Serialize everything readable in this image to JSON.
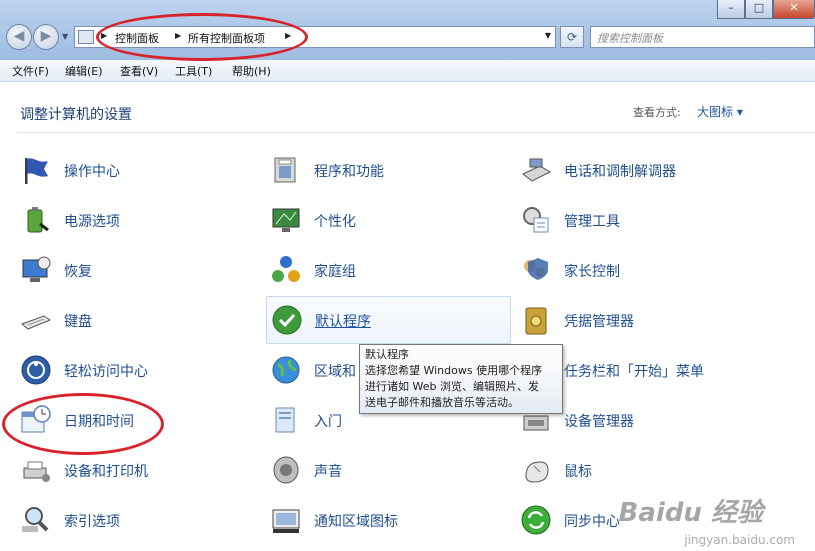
{
  "address": {
    "crumbs": [
      "控制面板",
      "所有控制面板项"
    ]
  },
  "search": {
    "placeholder": "搜索控制面板"
  },
  "menu": [
    "文件(F)",
    "编辑(E)",
    "查看(V)",
    "工具(T)",
    "帮助(H)"
  ],
  "header": {
    "title": "调整计算机的设置",
    "view_by_label": "查看方式:",
    "view_by_value": "大图标 ▾"
  },
  "items": [
    {
      "label": "操作中心",
      "icon": "action-center-flag-icon"
    },
    {
      "label": "程序和功能",
      "icon": "programs-features-icon"
    },
    {
      "label": "电话和调制解调器",
      "icon": "phone-modem-icon"
    },
    {
      "label": "电源选项",
      "icon": "power-battery-icon"
    },
    {
      "label": "个性化",
      "icon": "personalization-monitor-icon"
    },
    {
      "label": "管理工具",
      "icon": "admin-tools-icon"
    },
    {
      "label": "恢复",
      "icon": "recovery-computer-icon"
    },
    {
      "label": "家庭组",
      "icon": "homegroup-icon"
    },
    {
      "label": "家长控制",
      "icon": "parental-controls-icon"
    },
    {
      "label": "键盘",
      "icon": "keyboard-icon"
    },
    {
      "label": "默认程序",
      "icon": "default-programs-icon"
    },
    {
      "label": "凭据管理器",
      "icon": "credential-manager-icon"
    },
    {
      "label": "轻松访问中心",
      "icon": "ease-of-access-icon"
    },
    {
      "label": "区域和",
      "icon": "region-globe-icon"
    },
    {
      "label": "任务栏和「开始」菜单",
      "icon": "taskbar-icon"
    },
    {
      "label": "日期和时间",
      "icon": "date-time-calendar-icon"
    },
    {
      "label": "入门",
      "icon": "getting-started-icon"
    },
    {
      "label": "设备管理器",
      "icon": "device-manager-icon"
    },
    {
      "label": "设备和打印机",
      "icon": "devices-printers-icon"
    },
    {
      "label": "声音",
      "icon": "sound-speaker-icon"
    },
    {
      "label": "鼠标",
      "icon": "mouse-icon"
    },
    {
      "label": "索引选项",
      "icon": "indexing-magnifier-icon"
    },
    {
      "label": "通知区域图标",
      "icon": "notification-area-icon"
    },
    {
      "label": "同步中心",
      "icon": "sync-center-icon"
    }
  ],
  "tooltip": {
    "title": "默认程序",
    "line1": "选择您希望 Windows 使用哪个程序",
    "line2": "进行诸如 Web 浏览、编辑照片、发",
    "line3": "送电子邮件和播放音乐等活动。"
  },
  "watermark": {
    "text": "Baidu 经验",
    "sub": "jingyan.baidu.com"
  },
  "colors": {
    "annotation": "#d8232a",
    "link": "#1f4f8f",
    "title": "#1d3e78"
  }
}
